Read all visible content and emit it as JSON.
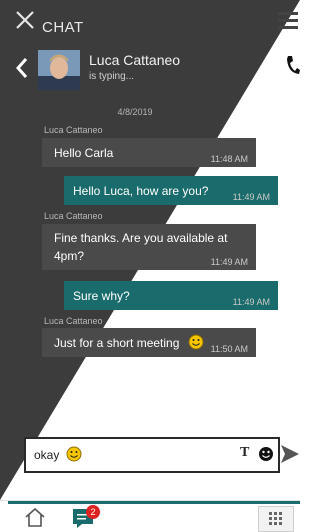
{
  "app": {
    "title": "CHAT"
  },
  "contact": {
    "name": "Luca Cattaneo",
    "status": "is typing..."
  },
  "conversation": {
    "date": "4/8/2019",
    "messages": [
      {
        "direction": "in",
        "sender": "Luca Cattaneo",
        "lines": [
          "Hello Carla"
        ],
        "time": "11:48 AM"
      },
      {
        "direction": "out",
        "sender": "",
        "lines": [
          "Hello Luca, how are you?"
        ],
        "time": "11:49 AM"
      },
      {
        "direction": "in",
        "sender": "Luca Cattaneo",
        "lines": [
          "Fine thanks. Are you available at",
          "4pm?"
        ],
        "time": "11:49 AM"
      },
      {
        "direction": "out",
        "sender": "",
        "lines": [
          "Sure why?"
        ],
        "time": "11:49 AM"
      },
      {
        "direction": "in",
        "sender": "Luca Cattaneo",
        "lines": [
          "Just for a short meeting"
        ],
        "time": "11:50 AM"
      }
    ]
  },
  "composer": {
    "value": "okay"
  },
  "nav": {
    "chat_badge": "2"
  },
  "colors": {
    "dark": "#3c3c3c",
    "accent": "#1a6b6b",
    "badge": "#dd2222"
  }
}
